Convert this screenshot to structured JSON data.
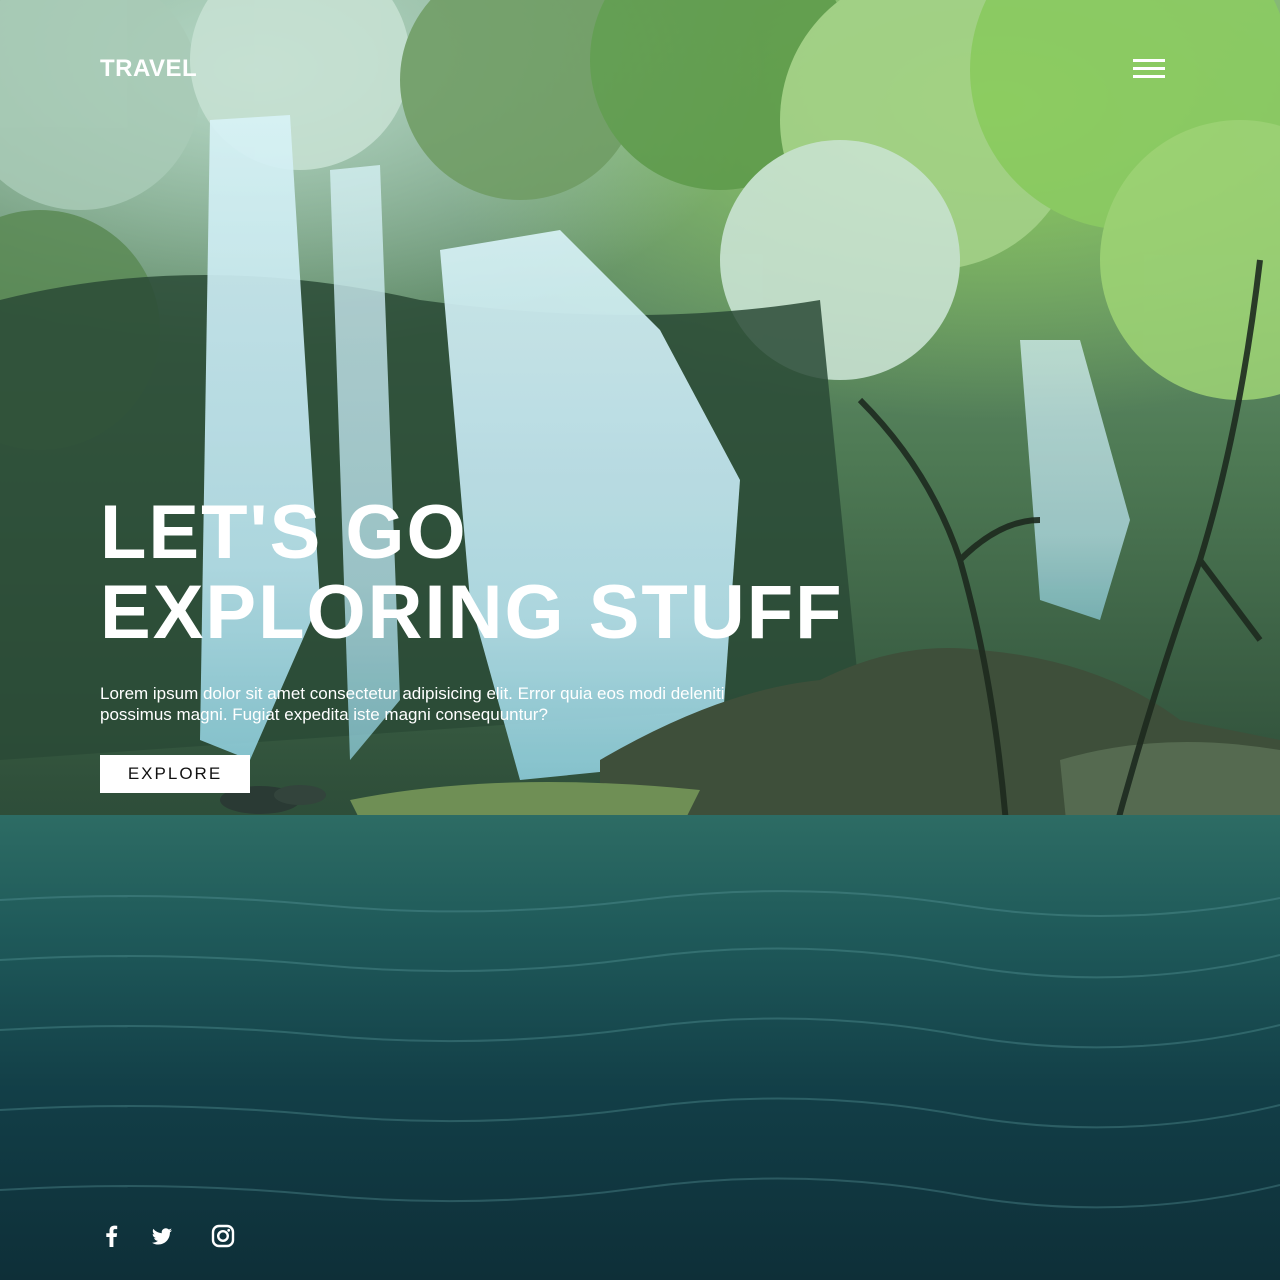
{
  "brand": {
    "name": "TRAVEL"
  },
  "nav": {
    "menu_icon": "hamburger-menu-icon"
  },
  "hero": {
    "title_line1": "LET'S GO",
    "title_line2": "EXPLORING STUFF",
    "description": "Lorem ipsum dolor sit amet consectetur adipisicing elit. Error quia eos modi deleniti possimus magni. Fugiat expedita iste magni consequuntur?",
    "button_label": "EXPLORE"
  },
  "social": {
    "icons": [
      "facebook-icon",
      "twitter-icon",
      "instagram-icon"
    ]
  },
  "background": {
    "icon": "waterfall-forest-lake-image"
  },
  "colors": {
    "text": "#ffffff",
    "button_bg": "#ffffff",
    "button_text": "#111111"
  }
}
